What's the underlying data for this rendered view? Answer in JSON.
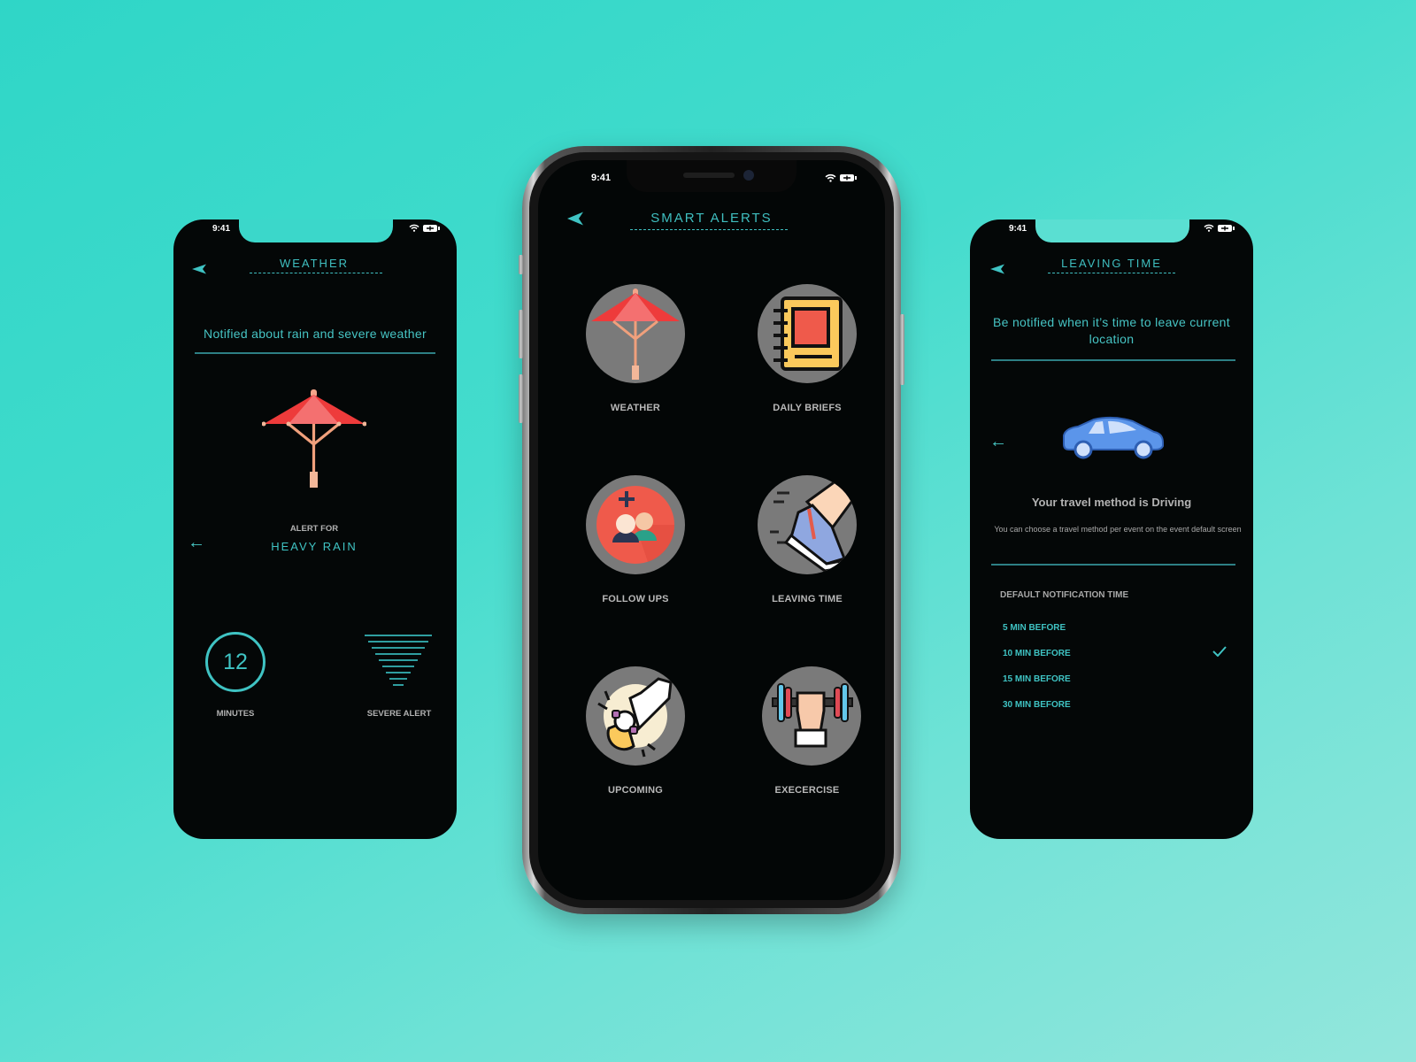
{
  "theme": {
    "accent": "#3fc3c3",
    "screen_bg": "#040707",
    "bg_start": "#2fd6c7",
    "bg_end": "#93e6dc",
    "label_grey": "#b8b8b8"
  },
  "left_phone": {
    "status_time": "9:41",
    "back_icon": "back-triangle-icon",
    "title": "WEATHER",
    "subtitle": "Notified about rain and severe weather",
    "illustration": "umbrella-icon",
    "alert_for_label": "ALERT FOR",
    "alert_value": "HEAVY RAIN",
    "prev_icon": "arrow-left-icon",
    "minutes_value": "12",
    "minutes_label": "MINUTES",
    "severity_label": "SEVERE ALERT",
    "severity_icon": "severity-funnel-icon"
  },
  "center_phone": {
    "status_time": "9:41",
    "back_icon": "back-triangle-icon",
    "title": "SMART ALERTS",
    "tiles": [
      {
        "label": "WEATHER",
        "icon": "umbrella-icon"
      },
      {
        "label": "DAILY BRIEFS",
        "icon": "notebook-icon"
      },
      {
        "label": "FOLLOW UPS",
        "icon": "add-people-icon"
      },
      {
        "label": "LEAVING TIME",
        "icon": "running-shoe-icon"
      },
      {
        "label": "UPCOMING",
        "icon": "wrist-watch-icon"
      },
      {
        "label": "EXECERCISE",
        "icon": "dumbbell-icon"
      }
    ]
  },
  "right_phone": {
    "status_time": "9:41",
    "back_icon": "back-triangle-icon",
    "title": "LEAVING TIME",
    "subtitle": "Be notified when it’s time to leave current location",
    "prev_icon": "arrow-left-icon",
    "illustration": "car-icon",
    "travel_heading": "Your travel method is Driving",
    "travel_note": "You can choose a travel method per event on the event default screen",
    "section_label": "DEFAULT NOTIFICATION TIME",
    "options": [
      {
        "label": "5 MIN BEFORE",
        "selected": false
      },
      {
        "label": "10 MIN BEFORE",
        "selected": true
      },
      {
        "label": "15 MIN BEFORE",
        "selected": false
      },
      {
        "label": "30 MIN BEFORE",
        "selected": false
      }
    ],
    "check_icon": "checkmark-icon"
  }
}
